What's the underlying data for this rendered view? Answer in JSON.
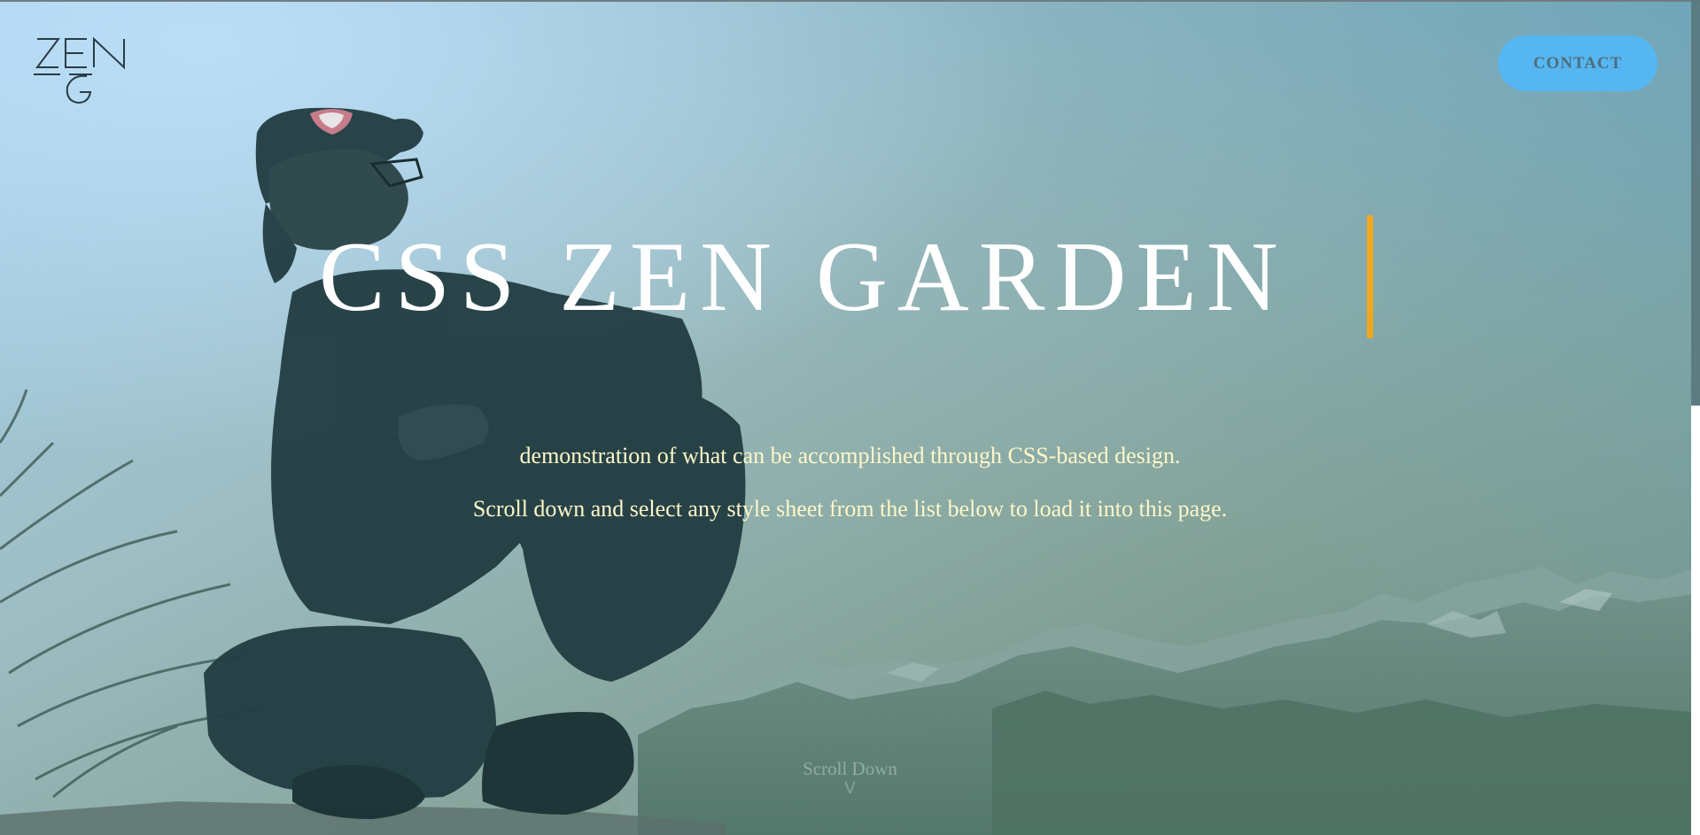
{
  "header": {
    "logo_letters": [
      "Z",
      "E",
      "N",
      "G"
    ],
    "contact_label": "CONTACT"
  },
  "hero": {
    "title": "CSS ZEN GARDEN",
    "intro_line_1": "demonstration of what can be accomplished through CSS-based design.",
    "intro_line_2": "Scroll down and select any style sheet from the list below to load it into this page.",
    "scroll_label": "Scroll Down",
    "scroll_chevron": "V"
  },
  "colors": {
    "accent_caret": "#f2a71c",
    "contact_bg": "#56b6f2",
    "intro_text": "#fdf7c8"
  }
}
